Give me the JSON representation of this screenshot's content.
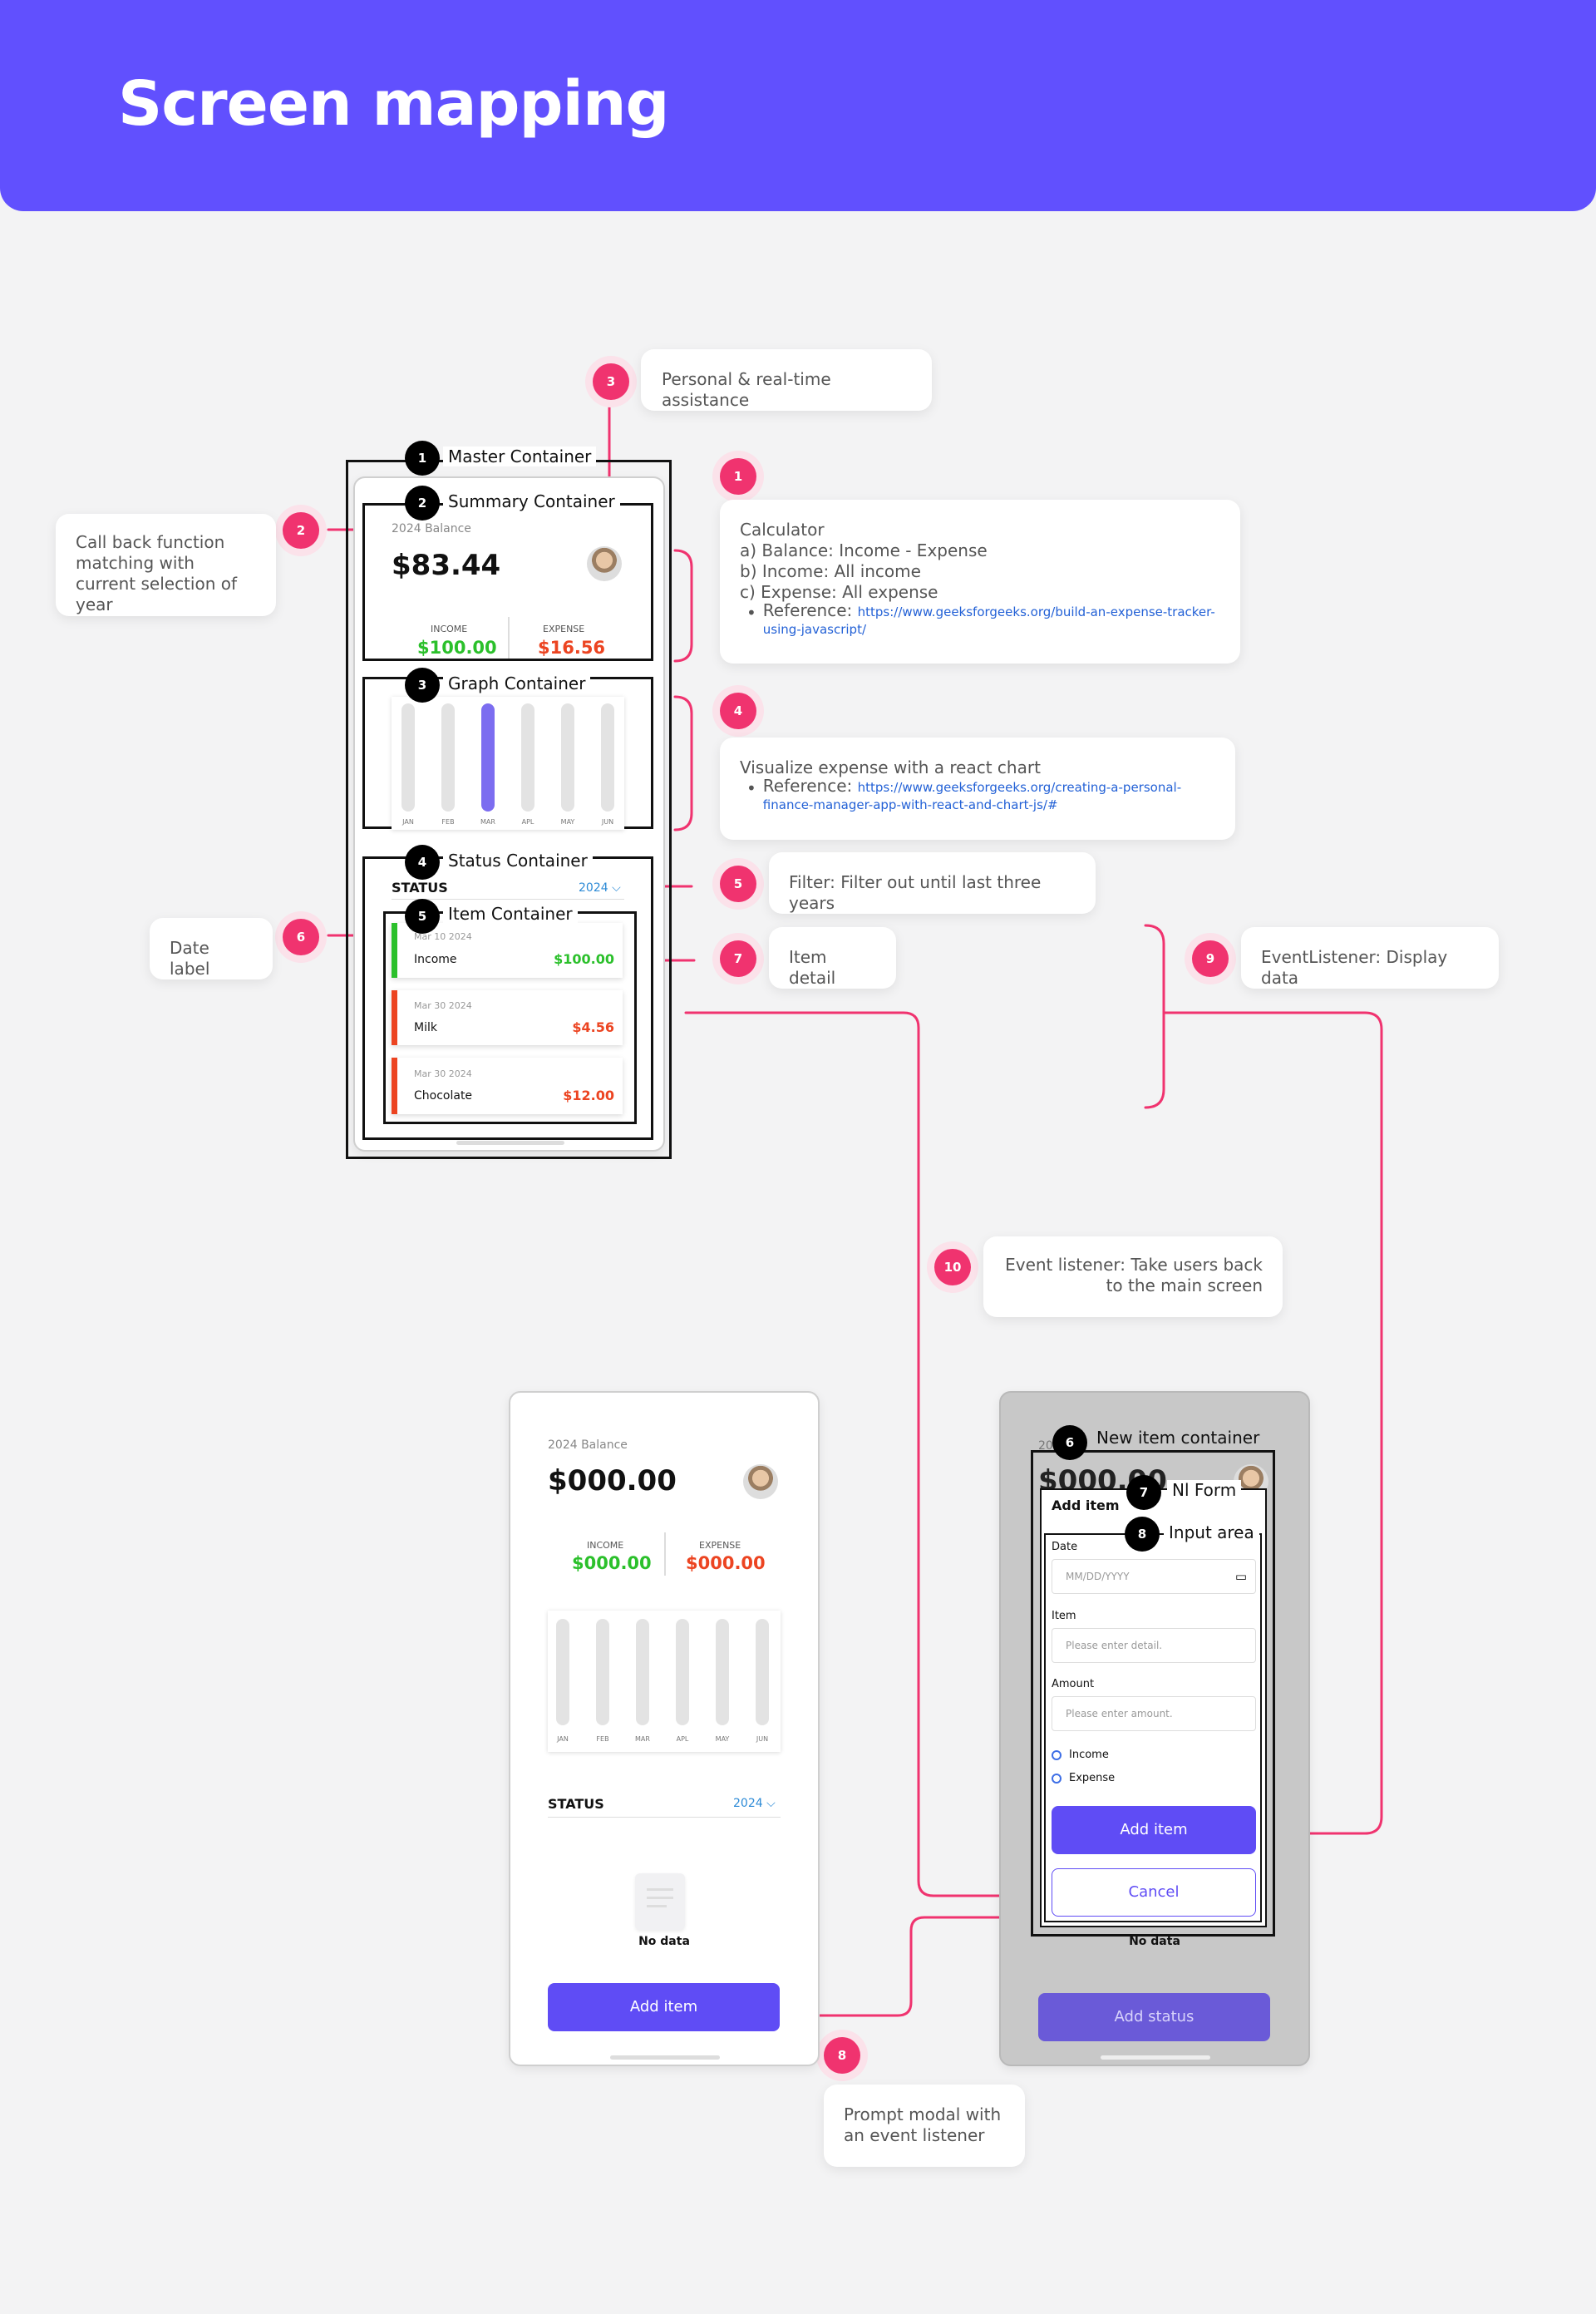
{
  "header": {
    "title": "Screen mapping"
  },
  "colors": {
    "accent": "#6150fe",
    "pin": "#f0336f",
    "income": "#2bc02b",
    "expense": "#ec4421"
  },
  "boxes": {
    "master": {
      "num": "1",
      "label": "Master Container"
    },
    "summary": {
      "num": "2",
      "label": "Summary Container"
    },
    "graph": {
      "num": "3",
      "label": "Graph Container"
    },
    "status": {
      "num": "4",
      "label": "Status Container"
    },
    "item": {
      "num": "5",
      "label": "Item Container"
    },
    "new_item": {
      "num": "6",
      "label": "New item container"
    },
    "nl_form": {
      "num": "7",
      "label": "Nl Form"
    },
    "input_area": {
      "num": "8",
      "label": "Input area"
    }
  },
  "notes": {
    "personal": {
      "num": "3",
      "text": "Personal & real-time assistance"
    },
    "callback": {
      "num": "2",
      "text": "Call back function matching with current selection of year"
    },
    "calculator": {
      "num": "1",
      "title": "Calculator",
      "lines": [
        "a) Balance: Income - Expense",
        "b) Income: All income",
        "c) Expense: All expense"
      ],
      "ref_label": "Reference:",
      "ref_link": "https://www.geeksforgeeks.org/build-an-expense-tracker-using-javascript/"
    },
    "visualize": {
      "num": "4",
      "title": "Visualize expense with a react chart",
      "ref_label": "Reference:",
      "ref_link": "https://www.geeksforgeeks.org/creating-a-personal-finance-manager-app-with-react-and-chart-js/#"
    },
    "filter": {
      "num": "5",
      "text": "Filter: Filter out until last three years"
    },
    "date_label": {
      "num": "6",
      "text": "Date label"
    },
    "item_detail": {
      "num": "7",
      "text": "Item detail"
    },
    "event_display": {
      "num": "9",
      "text": "EventListener: Display data"
    },
    "event_back": {
      "num": "10",
      "text": "Event listener: Take users back to the main screen"
    },
    "prompt": {
      "num": "8",
      "text": "Prompt modal with an event listener"
    }
  },
  "screen_main": {
    "balance_label": "2024 Balance",
    "balance": "$83.44",
    "income_label": "INCOME",
    "income": "$100.00",
    "expense_label": "EXPENSE",
    "expense": "$16.56",
    "months": [
      "JAN",
      "FEB",
      "MAR",
      "APL",
      "MAY",
      "JUN"
    ],
    "status_title": "STATUS",
    "year": "2024",
    "items": [
      {
        "date": "Mar 10 2024",
        "name": "Income",
        "amount": "$100.00"
      },
      {
        "date": "Mar 30 2024",
        "name": "Milk",
        "amount": "$4.56"
      },
      {
        "date": "Mar 30 2024",
        "name": "Chocolate",
        "amount": "$12.00"
      }
    ]
  },
  "screen_empty": {
    "balance_label": "2024 Balance",
    "balance": "$000.00",
    "income_label": "INCOME",
    "income": "$000.00",
    "expense_label": "EXPENSE",
    "expense": "$000.00",
    "months": [
      "JAN",
      "FEB",
      "MAR",
      "APL",
      "MAY",
      "JUN"
    ],
    "status_title": "STATUS",
    "year": "2024",
    "empty_text": "No data",
    "add_button": "Add item"
  },
  "screen_modal": {
    "partial_year": "20",
    "partial_balance": "$000.00",
    "form_title": "Add item",
    "date_label": "Date",
    "date_placeholder": "MM/DD/YYYY",
    "item_label": "Item",
    "item_placeholder": "Please enter detail.",
    "amount_label": "Amount",
    "amount_placeholder": "Please enter amount.",
    "radio_income": "Income",
    "radio_expense": "Expense",
    "add_button": "Add item",
    "cancel_button": "Cancel",
    "empty_text": "No data",
    "status_button": "Add status"
  }
}
